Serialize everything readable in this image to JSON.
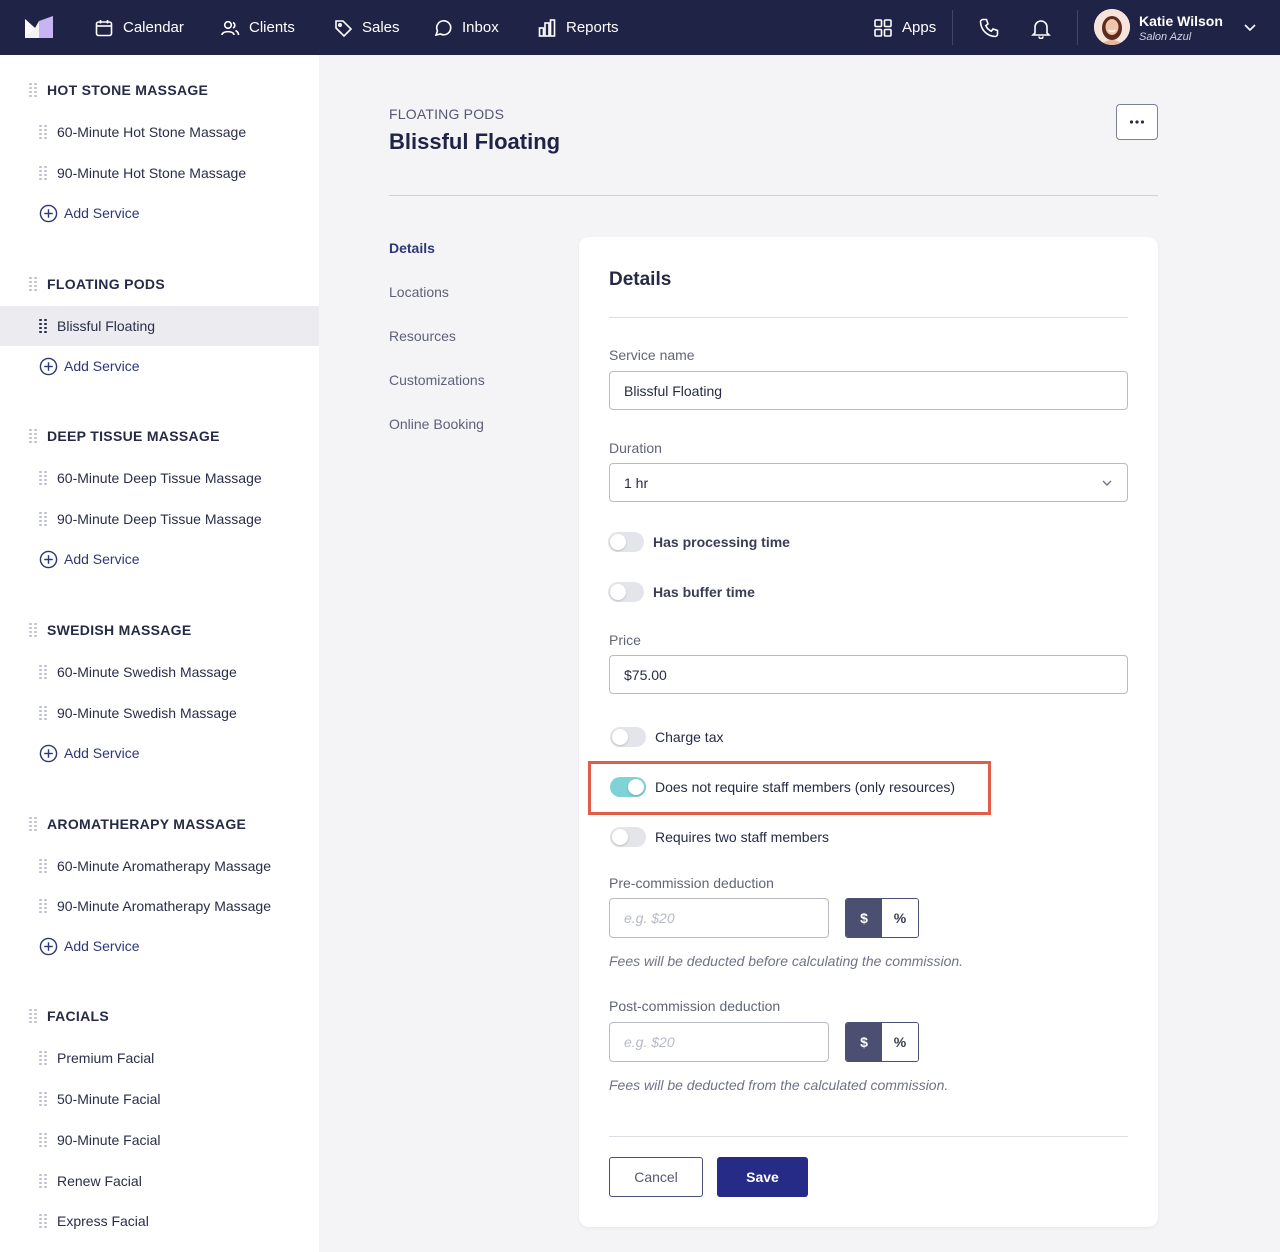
{
  "topbar": {
    "nav": [
      {
        "label": "Calendar",
        "icon": "calendar-icon"
      },
      {
        "label": "Clients",
        "icon": "users-icon"
      },
      {
        "label": "Sales",
        "icon": "tag-icon"
      },
      {
        "label": "Inbox",
        "icon": "chat-icon"
      },
      {
        "label": "Reports",
        "icon": "bar-chart-icon"
      }
    ],
    "apps_label": "Apps",
    "user": {
      "name": "Katie Wilson",
      "business": "Salon Azul"
    }
  },
  "sidebar": {
    "categories": [
      {
        "name": "HOT STONE MASSAGE",
        "services": [
          "60-Minute Hot Stone Massage",
          "90-Minute Hot Stone Massage"
        ],
        "add_label": "Add Service"
      },
      {
        "name": "FLOATING PODS",
        "services": [
          "Blissful Floating"
        ],
        "add_label": "Add Service"
      },
      {
        "name": "DEEP TISSUE MASSAGE",
        "services": [
          "60-Minute Deep Tissue Massage",
          "90-Minute Deep Tissue Massage"
        ],
        "add_label": "Add Service"
      },
      {
        "name": "SWEDISH MASSAGE",
        "services": [
          "60-Minute Swedish Massage",
          "90-Minute Swedish Massage"
        ],
        "add_label": "Add Service"
      },
      {
        "name": "AROMATHERAPY MASSAGE",
        "services": [
          "60-Minute Aromatherapy Massage",
          "90-Minute Aromatherapy Massage"
        ],
        "add_label": "Add Service"
      },
      {
        "name": "FACIALS",
        "services": [
          "Premium Facial",
          "50-Minute Facial",
          "90-Minute Facial",
          "Renew Facial",
          "Express Facial"
        ]
      }
    ],
    "active_service": "Blissful Floating"
  },
  "page": {
    "category": "FLOATING PODS",
    "title": "Blissful Floating",
    "subnav": [
      "Details",
      "Locations",
      "Resources",
      "Customizations",
      "Online Booking"
    ],
    "active_subnav": "Details"
  },
  "details": {
    "heading": "Details",
    "service_name_label": "Service name",
    "service_name_value": "Blissful Floating",
    "duration_label": "Duration",
    "duration_value": "1 hr",
    "processing_label": "Has processing time",
    "processing_on": false,
    "buffer_label": "Has buffer time",
    "buffer_on": false,
    "price_label": "Price",
    "price_value": "$75.00",
    "charge_tax_label": "Charge tax",
    "charge_tax_on": false,
    "no_staff_label": "Does not require staff members (only resources)",
    "no_staff_on": true,
    "two_staff_label": "Requires two staff members",
    "two_staff_on": false,
    "pre_label": "Pre-commission deduction",
    "pre_placeholder": "e.g. $20",
    "pre_help": "Fees will be deducted before calculating the commission.",
    "post_label": "Post-commission deduction",
    "post_placeholder": "e.g. $20",
    "post_help": "Fees will be deducted from the calculated commission.",
    "unit_dollar": "$",
    "unit_percent": "%",
    "cancel_label": "Cancel",
    "save_label": "Save"
  },
  "colors": {
    "nav_bg": "#1f2346",
    "primary": "#252b86",
    "toggle_on": "#7fd3d6",
    "highlight": "#e45d4b"
  }
}
